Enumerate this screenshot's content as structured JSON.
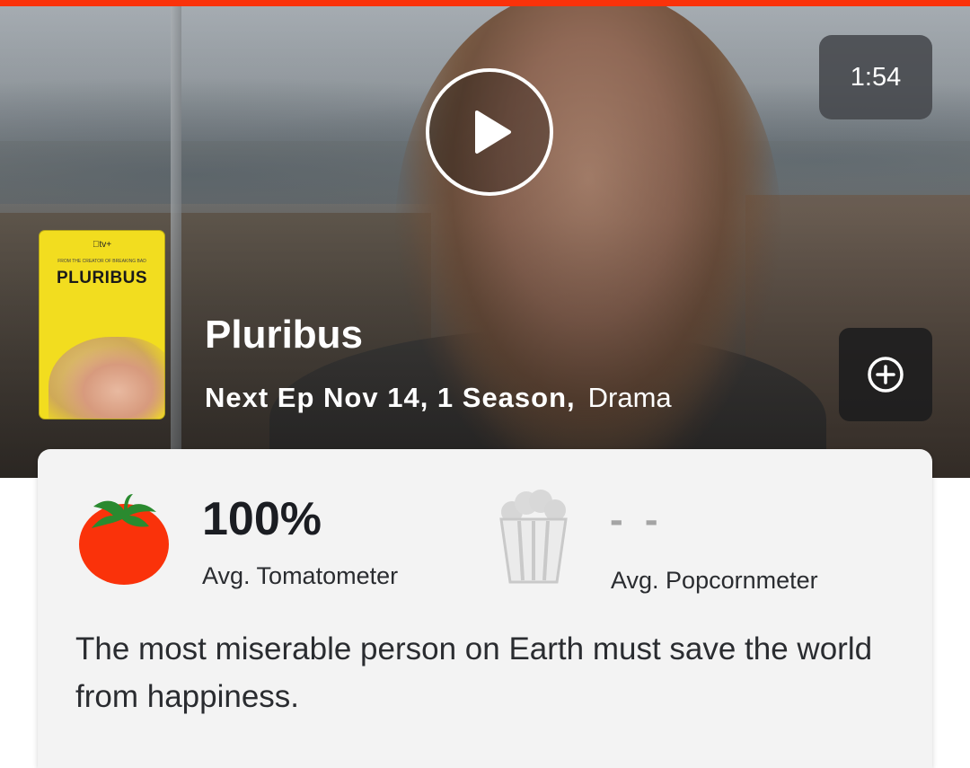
{
  "colors": {
    "accent_bar": "#fa320a",
    "tomato_red": "#fa320a",
    "tomato_leaf": "#2a8a2f",
    "card_bg": "#f3f3f3"
  },
  "hero": {
    "duration": "1:54",
    "play_icon": "play-icon",
    "add_icon": "plus-circle-icon"
  },
  "poster": {
    "brand": "tv+",
    "tagline": "FROM THE CREATOR OF BREAKING BAD",
    "title": "PLURIBUS"
  },
  "show": {
    "title": "Pluribus",
    "meta_bold": "Next Ep Nov 14, 1 Season,",
    "genre": "Drama"
  },
  "scores": {
    "tomatometer_value": "100%",
    "tomatometer_label": "Avg. Tomatometer",
    "tomatometer_icon": "tomato-icon",
    "popcornmeter_value": "- -",
    "popcornmeter_label": "Avg. Popcornmeter",
    "popcornmeter_icon": "popcorn-bucket-icon"
  },
  "synopsis": "The most miserable person on Earth must save the world from happiness."
}
